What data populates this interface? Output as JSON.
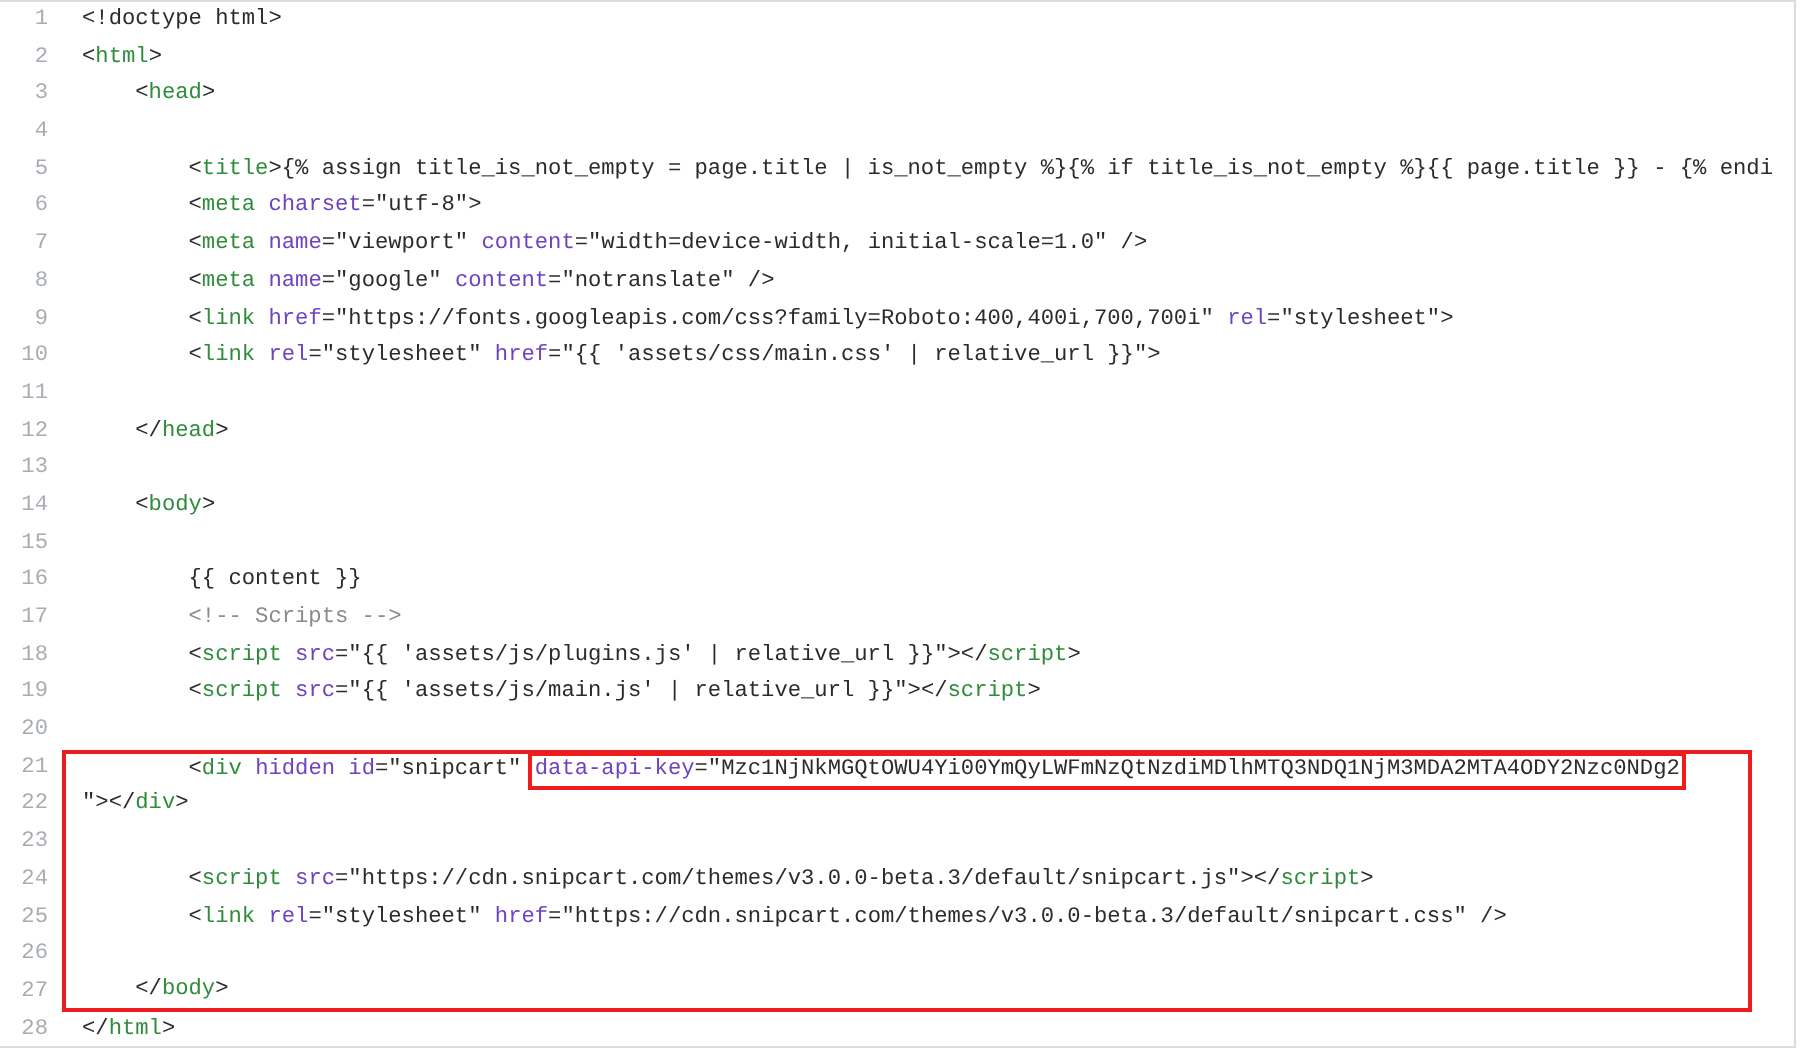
{
  "sections": [
    {
      "framed": false,
      "lines": [
        {
          "number": "1",
          "tokens": [
            {
              "kind": "plain",
              "text": "<!doctype html>"
            }
          ]
        },
        {
          "number": "2",
          "tokens": [
            {
              "kind": "plain",
              "text": "<"
            },
            {
              "kind": "tag",
              "text": "html"
            },
            {
              "kind": "plain",
              "text": ">"
            }
          ]
        },
        {
          "number": "3",
          "tokens": [
            {
              "kind": "plain",
              "text": "    <"
            },
            {
              "kind": "tag",
              "text": "head"
            },
            {
              "kind": "plain",
              "text": ">"
            }
          ]
        },
        {
          "number": "4"
        },
        {
          "number": "5",
          "tokens": [
            {
              "kind": "plain",
              "text": "        <"
            },
            {
              "kind": "tag",
              "text": "title"
            },
            {
              "kind": "plain",
              "text": ">{% assign title_is_not_empty = page.title | is_not_empty %}{% if title_is_not_empty %}{{ page.title }} - {% endi"
            }
          ]
        },
        {
          "number": "6",
          "tokens": [
            {
              "kind": "plain",
              "text": "        <"
            },
            {
              "kind": "tag",
              "text": "meta"
            },
            {
              "kind": "attr",
              "text": " charset"
            },
            {
              "kind": "plain",
              "text": "=\"utf-8\">"
            }
          ]
        },
        {
          "number": "7",
          "tokens": [
            {
              "kind": "plain",
              "text": "        <"
            },
            {
              "kind": "tag",
              "text": "meta"
            },
            {
              "kind": "attr",
              "text": " name"
            },
            {
              "kind": "plain",
              "text": "=\"viewport\" "
            },
            {
              "kind": "attr",
              "text": "content"
            },
            {
              "kind": "plain",
              "text": "=\"width=device-width, initial-scale=1.0\" />"
            }
          ]
        },
        {
          "number": "8",
          "tokens": [
            {
              "kind": "plain",
              "text": "        <"
            },
            {
              "kind": "tag",
              "text": "meta"
            },
            {
              "kind": "attr",
              "text": " name"
            },
            {
              "kind": "plain",
              "text": "=\"google\" "
            },
            {
              "kind": "attr",
              "text": "content"
            },
            {
              "kind": "plain",
              "text": "=\"notranslate\" />"
            }
          ]
        },
        {
          "number": "9",
          "tokens": [
            {
              "kind": "plain",
              "text": "        <"
            },
            {
              "kind": "tag",
              "text": "link"
            },
            {
              "kind": "attr",
              "text": " href"
            },
            {
              "kind": "plain",
              "text": "=\"https://fonts.googleapis.com/css?family=Roboto:400,400i,700,700i\" "
            },
            {
              "kind": "attr",
              "text": "rel"
            },
            {
              "kind": "plain",
              "text": "=\"stylesheet\">"
            }
          ]
        },
        {
          "number": "10",
          "tokens": [
            {
              "kind": "plain",
              "text": "        <"
            },
            {
              "kind": "tag",
              "text": "link"
            },
            {
              "kind": "attr",
              "text": " rel"
            },
            {
              "kind": "plain",
              "text": "=\"stylesheet\" "
            },
            {
              "kind": "attr",
              "text": "href"
            },
            {
              "kind": "plain",
              "text": "=\"{{ 'assets/css/main.css' | relative_url }}\">"
            }
          ]
        },
        {
          "number": "11"
        },
        {
          "number": "12",
          "tokens": [
            {
              "kind": "plain",
              "text": "    </"
            },
            {
              "kind": "tag",
              "text": "head"
            },
            {
              "kind": "plain",
              "text": ">"
            }
          ]
        },
        {
          "number": "13"
        },
        {
          "number": "14",
          "tokens": [
            {
              "kind": "plain",
              "text": "    <"
            },
            {
              "kind": "tag",
              "text": "body"
            },
            {
              "kind": "plain",
              "text": ">"
            }
          ]
        },
        {
          "number": "15"
        },
        {
          "number": "16",
          "tokens": [
            {
              "kind": "plain",
              "text": "        {{ content }}"
            }
          ]
        },
        {
          "number": "17",
          "tokens": [
            {
              "kind": "comment",
              "text": "        <!-- Scripts -->"
            }
          ]
        },
        {
          "number": "18",
          "tokens": [
            {
              "kind": "plain",
              "text": "        <"
            },
            {
              "kind": "tag",
              "text": "script"
            },
            {
              "kind": "attr",
              "text": " src"
            },
            {
              "kind": "plain",
              "text": "=\"{{ 'assets/js/plugins.js' | relative_url }}\"></"
            },
            {
              "kind": "tag",
              "text": "script"
            },
            {
              "kind": "plain",
              "text": ">"
            }
          ]
        },
        {
          "number": "19",
          "tokens": [
            {
              "kind": "plain",
              "text": "        <"
            },
            {
              "kind": "tag",
              "text": "script"
            },
            {
              "kind": "attr",
              "text": " src"
            },
            {
              "kind": "plain",
              "text": "=\"{{ 'assets/js/main.js' | relative_url }}\"></"
            },
            {
              "kind": "tag",
              "text": "script"
            },
            {
              "kind": "plain",
              "text": ">"
            }
          ]
        },
        {
          "number": "20"
        }
      ]
    },
    {
      "framed": true,
      "lines": [
        {
          "number": "21",
          "tokens": [
            {
              "kind": "plain",
              "text": "        <"
            },
            {
              "kind": "tag",
              "text": "div"
            },
            {
              "kind": "attr",
              "text": " hidden id"
            },
            {
              "kind": "plain",
              "text": "=\"snipcart\" "
            }
          ],
          "boxed_tokens": [
            {
              "kind": "attr",
              "text": "data-api-key"
            },
            {
              "kind": "plain",
              "text": "=\"Mzc1NjNkMGQtOWU4Yi00YmQyLWFmNzQtNzdiMDlhMTQ3NDQ1NjM3MDA2MTA4ODY2Nzc0NDg2"
            }
          ]
        },
        {
          "number": "22",
          "tokens": [
            {
              "kind": "plain",
              "text": "\"></"
            },
            {
              "kind": "tag",
              "text": "div"
            },
            {
              "kind": "plain",
              "text": ">"
            }
          ]
        },
        {
          "number": "23"
        },
        {
          "number": "24",
          "tokens": [
            {
              "kind": "plain",
              "text": "        <"
            },
            {
              "kind": "tag",
              "text": "script"
            },
            {
              "kind": "attr",
              "text": " src"
            },
            {
              "kind": "plain",
              "text": "=\"https://cdn.snipcart.com/themes/v3.0.0-beta.3/default/snipcart.js\"></"
            },
            {
              "kind": "tag",
              "text": "script"
            },
            {
              "kind": "plain",
              "text": ">"
            }
          ]
        },
        {
          "number": "25",
          "tokens": [
            {
              "kind": "plain",
              "text": "        <"
            },
            {
              "kind": "tag",
              "text": "link"
            },
            {
              "kind": "attr",
              "text": " rel"
            },
            {
              "kind": "plain",
              "text": "=\"stylesheet\" "
            },
            {
              "kind": "attr",
              "text": "href"
            },
            {
              "kind": "plain",
              "text": "=\"https://cdn.snipcart.com/themes/v3.0.0-beta.3/default/snipcart.css\" />"
            }
          ]
        },
        {
          "number": "26"
        },
        {
          "number": "27",
          "tokens": [
            {
              "kind": "plain",
              "text": "    </"
            },
            {
              "kind": "tag",
              "text": "body"
            },
            {
              "kind": "plain",
              "text": ">"
            }
          ]
        }
      ]
    },
    {
      "framed": false,
      "lines": [
        {
          "number": "28",
          "tokens": [
            {
              "kind": "plain",
              "text": "</"
            },
            {
              "kind": "tag",
              "text": "html"
            },
            {
              "kind": "plain",
              "text": ">"
            }
          ]
        }
      ]
    }
  ]
}
